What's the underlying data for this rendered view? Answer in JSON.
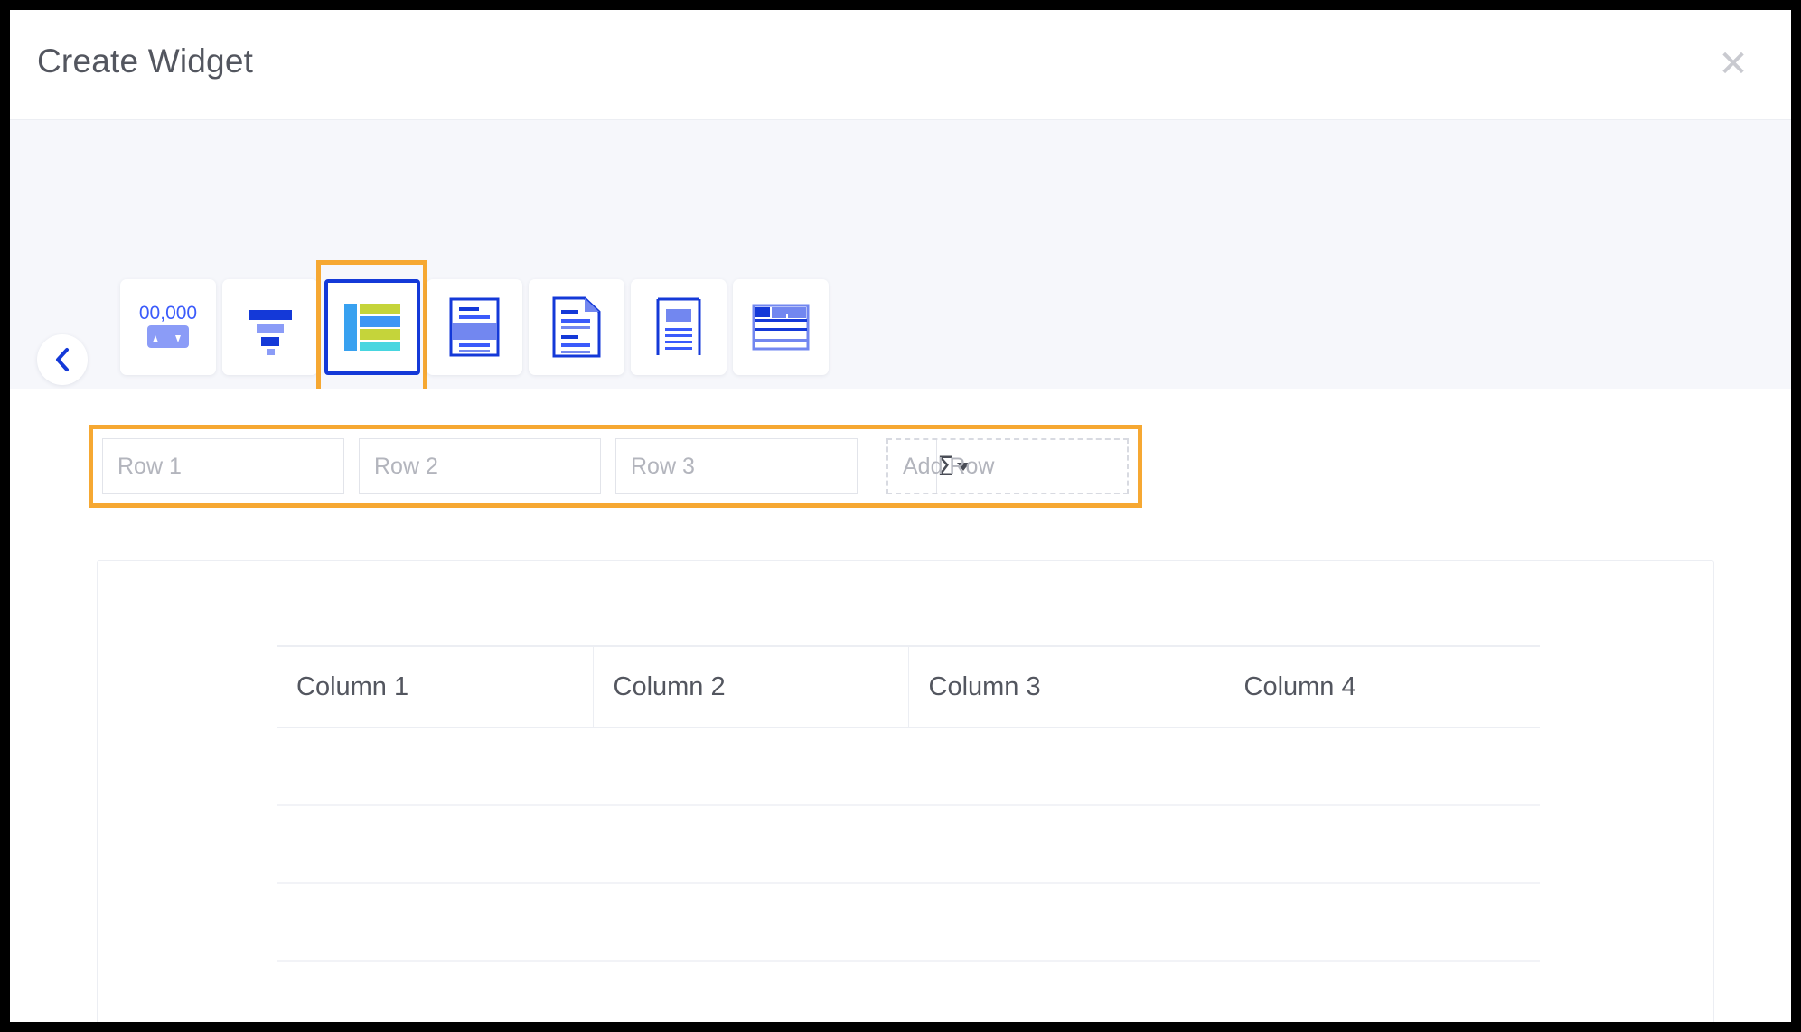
{
  "window": {
    "title": "Create Widget",
    "close_icon": "close-icon"
  },
  "accent_colors": {
    "highlight_orange": "#f6a832",
    "selected_blue": "#1439d8",
    "icon_blue": "#3b5bfb",
    "text_gray": "#53565f",
    "placeholder_gray": "#b3b5bd",
    "strip_bg": "#f6f7fb"
  },
  "type_picker": {
    "prev_icon": "chevron-left-icon",
    "selected_index": 2,
    "items": [
      {
        "label": "Counter",
        "icon": "counter-icon"
      },
      {
        "label": "Funnel",
        "icon": "funnel-icon"
      },
      {
        "label": "Summary Table",
        "icon": "summary-table-icon"
      },
      {
        "label": "Post Card",
        "icon": "post-card-icon"
      },
      {
        "label": "Text",
        "icon": "text-icon"
      },
      {
        "label": "Title",
        "icon": "title-icon"
      },
      {
        "label": "Grouped Summary",
        "icon": "grouped-summary-icon"
      }
    ],
    "counter_icon_text": "00,000"
  },
  "row_builder": {
    "fields": [
      {
        "placeholder": "Row 1",
        "value": "",
        "agg_icon": "sigma-dropdown-icon"
      },
      {
        "placeholder": "Row 2",
        "value": "",
        "agg_icon": "sigma-dropdown-icon"
      },
      {
        "placeholder": "Row 3",
        "value": "",
        "agg_icon": "sigma-dropdown-icon"
      }
    ],
    "add_row_label": "Add Row"
  },
  "preview": {
    "columns": [
      "Column 1",
      "Column 2",
      "Column 3",
      "Column 4"
    ],
    "empty_row_count": 4
  }
}
